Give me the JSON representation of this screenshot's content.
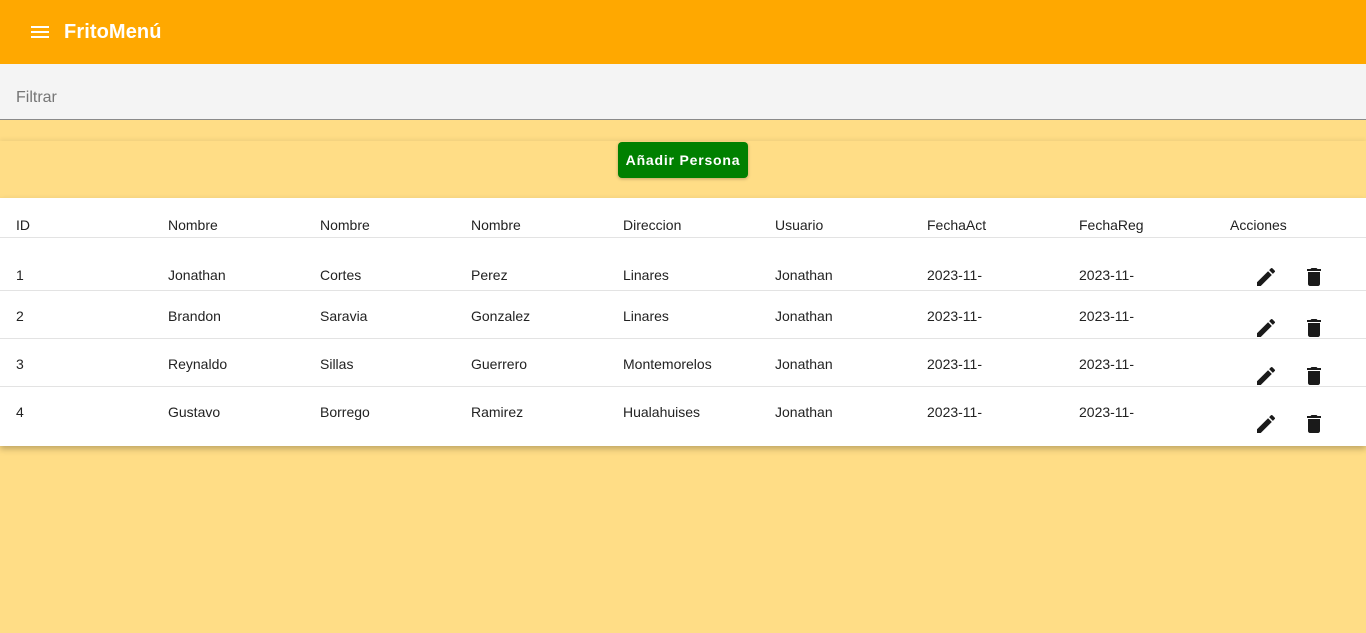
{
  "app": {
    "title": "FritoMenú"
  },
  "filter": {
    "placeholder": "Filtrar",
    "value": ""
  },
  "add_button": {
    "label": "Añadir Persona"
  },
  "table": {
    "columns": [
      "ID",
      "Nombre",
      "Nombre",
      "Nombre",
      "Direccion",
      "Usuario",
      "FechaAct",
      "FechaReg",
      "Acciones"
    ],
    "rows": [
      {
        "id": "1",
        "nombre": "Jonathan",
        "apellido1": "Cortes",
        "apellido2": "Perez",
        "direccion": "Linares",
        "usuario": "Jonathan",
        "fecha_act": "2023-11-",
        "fecha_reg": "2023-11-"
      },
      {
        "id": "2",
        "nombre": "Brandon",
        "apellido1": "Saravia",
        "apellido2": "Gonzalez",
        "direccion": "Linares",
        "usuario": "Jonathan",
        "fecha_act": "2023-11-",
        "fecha_reg": "2023-11-"
      },
      {
        "id": "3",
        "nombre": "Reynaldo",
        "apellido1": "Sillas",
        "apellido2": "Guerrero",
        "direccion": "Montemorelos",
        "usuario": "Jonathan",
        "fecha_act": "2023-11-",
        "fecha_reg": "2023-11-"
      },
      {
        "id": "4",
        "nombre": "Gustavo",
        "apellido1": "Borrego",
        "apellido2": "Ramirez",
        "direccion": "Hualahuises",
        "usuario": "Jonathan",
        "fecha_act": "2023-11-",
        "fecha_reg": "2023-11-"
      }
    ]
  },
  "icons": {
    "menu": "menu-icon",
    "edit": "pencil-icon",
    "delete": "trash-icon"
  },
  "colors": {
    "toolbar": "#ffa800",
    "background": "#ffdd86",
    "add_button": "#008000"
  }
}
